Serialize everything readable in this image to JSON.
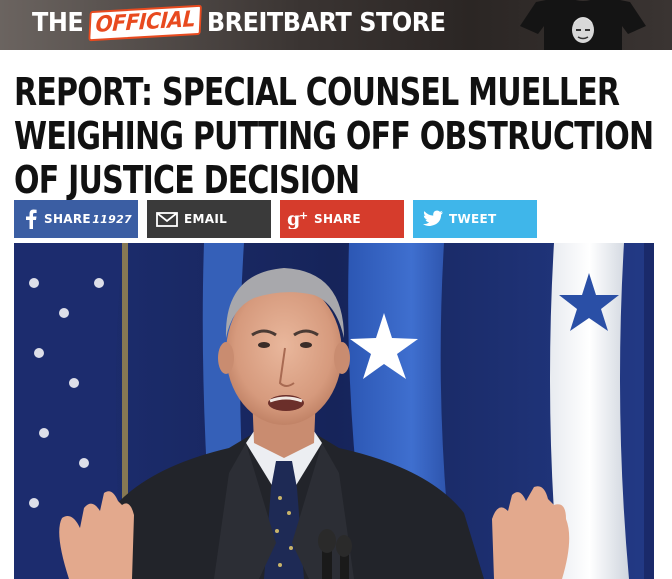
{
  "banner": {
    "prefix": "THE",
    "official": "OFFICIAL",
    "brand": "BREITBART STORE"
  },
  "article": {
    "headline": "REPORT: SPECIAL COUNSEL MUELLER WEIGHING PUTTING OFF OBSTRUCTION OF JUSTICE DECISION"
  },
  "share": {
    "facebook": {
      "label": "SHARE",
      "count": "11927",
      "icon": "facebook-icon",
      "color": "#3b5ea3"
    },
    "email": {
      "label": "EMAIL",
      "icon": "envelope-icon",
      "color": "#3a3a3a"
    },
    "googleplus": {
      "label": "SHARE",
      "icon": "google-plus-icon",
      "color": "#d63c2c"
    },
    "twitter": {
      "label": "TWEET",
      "icon": "twitter-bird-icon",
      "color": "#3fb6ea"
    }
  },
  "photo": {
    "subject": "man in suit speaking in front of flags"
  }
}
